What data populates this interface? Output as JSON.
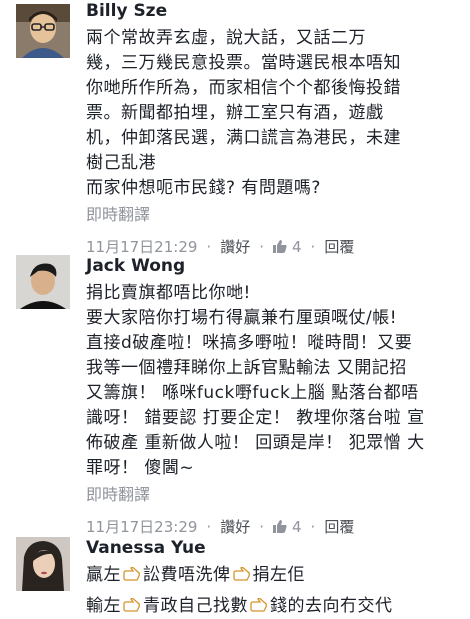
{
  "comments": [
    {
      "author": "Billy Sze",
      "text": "兩个常故弄玄虛，說大話，又話二万\n幾，三万幾民意投票。當時選民根本唔知\n你哋所作所為，而家相信个个都後悔投錯\n票。新聞都拍埋，辦工室只有酒，遊戲\n机，仲卸落民選，满口謊言為港民，未建\n樹己乱港\n而家仲想呃市民錢? 有問題嗎?",
      "translate": "即時翻譯",
      "timestamp": "11月17日21:29",
      "like_label": "讚好",
      "like_count": "4",
      "reply_label": "回覆",
      "like_icon": "thumbs-up-icon"
    },
    {
      "author": "Jack Wong",
      "text": "捐比賣旗都唔比你哋!\n要大家陪你打場冇得贏兼冇厘頭嘅仗/帳!\n直接d破產啦！咪搞多嘢啦！嘥時間！又要\n我等一個禮拜睇你上訴官點輸法 又開記招\n又籌旗！ 喺咪fuck嘢fuck上腦 點落台都唔\n識呀！ 錯要認 打要企定！ 教埋你落台啦 宣\n佈破產 重新做人啦！ 回頭是岸！ 犯眾憎 大\n罪呀！ 傻閪~",
      "translate": "即時翻譯",
      "timestamp": "11月17日23:29",
      "like_label": "讚好",
      "like_count": "4",
      "reply_label": "回覆",
      "like_icon": "thumbs-up-icon"
    },
    {
      "author": "Vanessa Yue",
      "line1_a": "贏左",
      "line1_b": "訟費唔洗俾",
      "line1_c": "捐左佢",
      "line2_a": "輸左",
      "line2_b": "青政自己找數",
      "line2_c": "錢的去向冇交代",
      "inline_icon": "pointing-hand-icon"
    }
  ],
  "colors": {
    "meta": "#90949c",
    "text": "#1d2129"
  }
}
